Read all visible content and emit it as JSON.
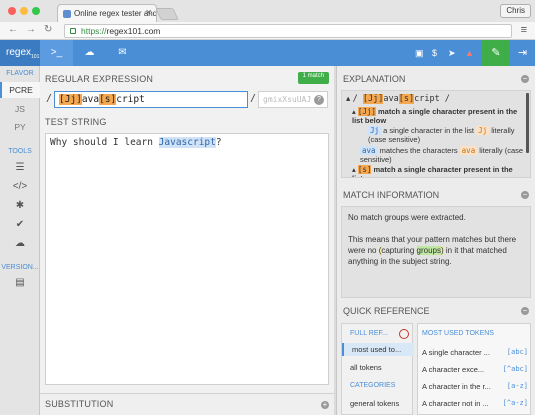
{
  "browser": {
    "tab_title": "Online regex tester and de",
    "profile": "Chris",
    "url_scheme": "https://",
    "url_host": "regex101.com"
  },
  "app": {
    "logo_main": "regex",
    "logo_sub": "101",
    "header_icons": [
      "prompt-icon",
      "cloud-icon",
      "chat-icon",
      "list-icon",
      "dollar-icon",
      "send-icon",
      "alert-icon",
      "wrench-icon",
      "sign-in-icon"
    ]
  },
  "sidebar": {
    "flavor_label": "FLAVOR",
    "flavors": [
      "PCRE",
      "JS",
      "PY"
    ],
    "tools_label": "TOOLS",
    "version_label": "VERSION..."
  },
  "regex": {
    "title": "REGULAR EXPRESSION",
    "match_badge": "1 match",
    "delimiter": "/",
    "tokens": [
      "[Jj]",
      "ava",
      "[s]",
      "cript"
    ],
    "flags_placeholder": "gmixXsuUAJ",
    "help": "?"
  },
  "test_string": {
    "title": "TEST STRING",
    "before": "Why should I learn ",
    "match": "Javascript",
    "after": "?"
  },
  "substitution": {
    "title": "SUBSTITUTION",
    "plus": "+"
  },
  "explanation": {
    "title": "EXPLANATION",
    "collapse": "−",
    "header_prefix": "/ ",
    "header_suffix": " /",
    "l1_token": "[Jj]",
    "l1_text": " match a single character present in the list below",
    "l2_chip": "Jj",
    "l2_text": " a single character in the list ",
    "l2_chip2": "Jj",
    "l2_text2": " literally (case sensitive)",
    "l3_chip": "ava",
    "l3_text": " matches the characters ",
    "l3_chip2": "ava",
    "l3_text2": " literally (case sensitive)",
    "l4_token": "[s]",
    "l4_text": " match a single character present in the list"
  },
  "match_info": {
    "title": "MATCH INFORMATION",
    "line1": "No match groups were extracted.",
    "line2a": "This means that your pattern matches but there were no ",
    "paren_open": "(",
    "capturing": "capturing ",
    "groups": "groups",
    "paren_close": ")",
    "line2b": " in it that matched anything in the subject string."
  },
  "quick_reference": {
    "title": "QUICK REFERENCE",
    "full_ref": "FULL REF...",
    "categories_left": [
      "most used to...",
      "all tokens"
    ],
    "categories_label": "CATEGORIES",
    "general_tokens": "general tokens",
    "right_head": "MOST USED TOKENS",
    "rows": [
      {
        "label": "A single character ...",
        "code": "[abc]"
      },
      {
        "label": "A character exce...",
        "code": "[^abc]"
      },
      {
        "label": "A character in the r...",
        "code": "[a-z]"
      },
      {
        "label": "A character not in ...",
        "code": "[^a-z]"
      }
    ]
  }
}
